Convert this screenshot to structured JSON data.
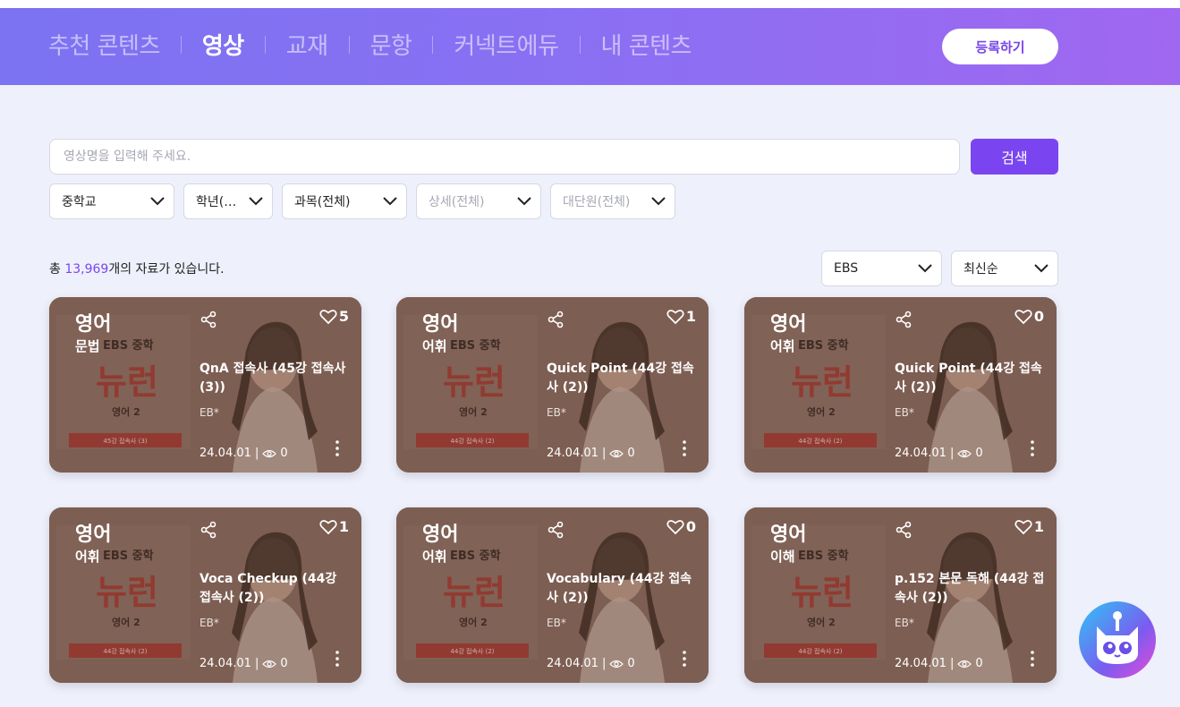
{
  "header": {
    "nav": [
      {
        "label": "추천 콘텐츠",
        "active": false
      },
      {
        "label": "영상",
        "active": true
      },
      {
        "label": "교재",
        "active": false
      },
      {
        "label": "문항",
        "active": false
      },
      {
        "label": "커넥트에듀",
        "active": false
      },
      {
        "label": "내 콘텐츠",
        "active": false
      }
    ],
    "register_label": "등록하기"
  },
  "search": {
    "placeholder": "영상명을 입력해 주세요.",
    "button_label": "검색"
  },
  "filters": [
    {
      "value": "중학교",
      "disabled": false
    },
    {
      "value": "학년(…",
      "disabled": false
    },
    {
      "value": "과목(전체)",
      "disabled": false
    },
    {
      "value": "상세(전체)",
      "disabled": true
    },
    {
      "value": "대단원(전체)",
      "disabled": true
    }
  ],
  "results": {
    "prefix": "총 ",
    "count": "13,969",
    "suffix": "개의 자료가 있습니다.",
    "source_select": "EBS",
    "sort_select": "최신순"
  },
  "cards": [
    {
      "subject": "영어",
      "category": "문법",
      "likes": "5",
      "title": "QnA 접속사 (45강 접속사 (3))",
      "author": "EB*",
      "date": "24.04.01",
      "views": "0",
      "thumb_tag": "45강 접속사 (3)"
    },
    {
      "subject": "영어",
      "category": "어휘",
      "likes": "1",
      "title": "Quick Point (44강 접속사 (2))",
      "author": "EB*",
      "date": "24.04.01",
      "views": "0",
      "thumb_tag": "44강 접속사 (2)"
    },
    {
      "subject": "영어",
      "category": "어휘",
      "likes": "0",
      "title": "Quick Point (44강 접속사 (2))",
      "author": "EB*",
      "date": "24.04.01",
      "views": "0",
      "thumb_tag": "44강 접속사 (2)"
    },
    {
      "subject": "영어",
      "category": "어휘",
      "likes": "1",
      "title": "Voca Checkup (44강 접속사 (2))",
      "author": "EB*",
      "date": "24.04.01",
      "views": "0",
      "thumb_tag": "44강 접속사 (2)"
    },
    {
      "subject": "영어",
      "category": "어휘",
      "likes": "0",
      "title": "Vocabulary (44강 접속사 (2))",
      "author": "EB*",
      "date": "24.04.01",
      "views": "0",
      "thumb_tag": "44강 접속사 (2)"
    },
    {
      "subject": "영어",
      "category": "이해",
      "likes": "1",
      "title": "p.152 본문 독해 (44강 접속사 (2))",
      "author": "EB*",
      "date": "24.04.01",
      "views": "0",
      "thumb_tag": "44강 접속사 (2)"
    }
  ],
  "thumbnail": {
    "brand": "EBS 중학",
    "series": "뉴런",
    "course": "영어 2"
  },
  "colors": {
    "accent": "#7a45f0",
    "header_start": "#7b73f2",
    "header_end": "#a067f0",
    "page_bg": "#eef0fb"
  }
}
